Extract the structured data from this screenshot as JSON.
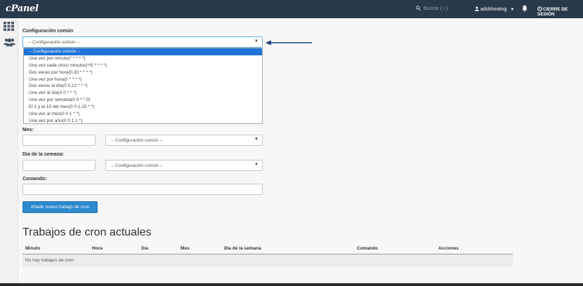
{
  "topbar": {
    "logo": "cPanel",
    "search_placeholder": "Buscar ( / )",
    "username": "adckhosting",
    "logout_label": "CIERRE DE SESIÓN"
  },
  "form": {
    "common_label": "Configuración común",
    "common_select_value": "-- Configuración común --",
    "dropdown_options": [
      "-- Configuración común --",
      "Una vez por minuto(* * * * *)",
      "Una vez cada cinco minutos(*/5 * * * *)",
      "Dos veces por hora(0,30 * * * *)",
      "Una vez por hora(0 * * * *)",
      "Dos veces al día(0 0,12 * * *)",
      "Una vez al día(0 0 * * *)",
      "Una vez por semana(0 0 * * 0)",
      "El 1 y el 15 del mes(0 0 1,15 * *)",
      "Una vez al mes(0 0 1 * *)",
      "Una vez por año(0 0 1 1 *)"
    ],
    "month_label": "Mes:",
    "month_select_value": "-- Configuración común --",
    "weekday_label": "Día de la semana:",
    "weekday_select_value": "-- Configuración común --",
    "command_label": "Comando:",
    "submit_label": "Añadir nuevo trabajo de cron"
  },
  "current_jobs": {
    "title": "Trabajos de cron actuales",
    "columns": [
      "Minuto",
      "Hora",
      "Día",
      "Mes",
      "Día de la semana",
      "Comando",
      "Acciones"
    ],
    "empty_message": "No hay trabajos de cron"
  }
}
